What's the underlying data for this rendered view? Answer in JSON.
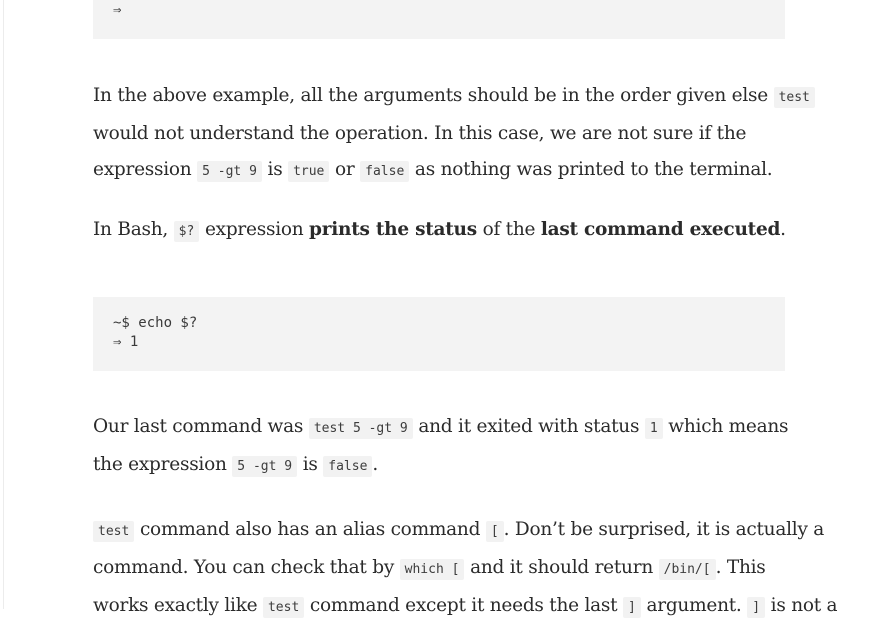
{
  "code_block_top": {
    "line": "⇒"
  },
  "para1": {
    "l1_a": "In the above example, all the arguments should be in the order given else ",
    "l1_code": "test",
    "l2": "would not understand the operation. In this case, we are not sure if the",
    "l3_a": "expression ",
    "l3_code1": "5 -gt 9",
    "l3_b": " is ",
    "l3_code2": "true",
    "l3_c": " or ",
    "l3_code3": "false",
    "l3_d": " as nothing was printed to the terminal."
  },
  "para2": {
    "a": "In Bash, ",
    "code": "$?",
    "b": " expression ",
    "strong1": "prints the status",
    "c": " of the ",
    "strong2": "last command executed",
    "d": "."
  },
  "code_block_echo": {
    "line1": "~$ echo $?",
    "line2": "⇒ 1"
  },
  "para3": {
    "l1_a": "Our last command was ",
    "l1_code1": "test 5 -gt 9",
    "l1_b": " and it exited with status ",
    "l1_code2": "1",
    "l1_c": " which means",
    "l2_a": "the expression ",
    "l2_code1": "5 -gt 9",
    "l2_b": " is ",
    "l2_code2": "false",
    "l2_c": "."
  },
  "para4": {
    "l1_code1": "test",
    "l1_a": " command also has an alias command ",
    "l1_code2": "[",
    "l1_b": ". Don’t be surprised, it is actually a",
    "l2_a": "command. You can check that by ",
    "l2_code1": "which [",
    "l2_b": " and it should return ",
    "l2_code2": "/bin/[",
    "l2_c": ". This",
    "l3_a": "works exactly like ",
    "l3_code1": "test",
    "l3_b": " command except it needs the last ",
    "l3_code2": "]",
    "l3_c": " argument. ",
    "l3_code3": "]",
    "l3_d": " is not a"
  }
}
